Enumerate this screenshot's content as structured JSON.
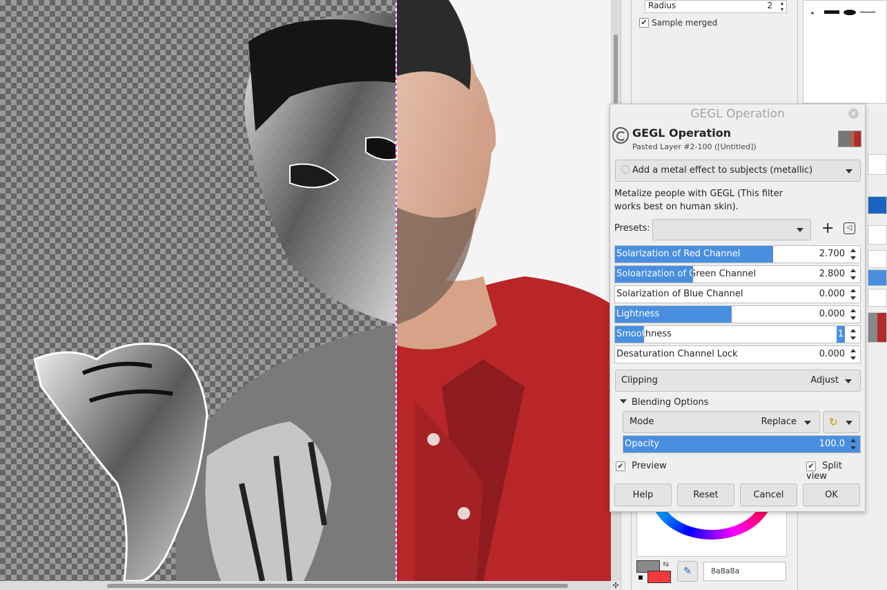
{
  "canvas": {
    "split_view_enabled": true
  },
  "tool_options": {
    "radius_label": "Radius",
    "radius_value": "2",
    "sample_merged_label": "Sample merged",
    "sample_merged_checked": true
  },
  "colors": {
    "foreground": "#8a8a8a",
    "background": "#f23a3a",
    "hex_value": "8a8a8a",
    "accent": "#4a8fdf"
  },
  "dialog": {
    "window_title": "GEGL Operation",
    "close_icon": "close-icon",
    "heading": "GEGL Operation",
    "subheading": "Pasted Layer #2-100 ([Untitled])",
    "filter_selected": "Add a metal effect to subjects (metallic)",
    "description": "Metalize people with GEGL (This filter works best on human skin).",
    "presets_label": "Presets:",
    "presets_value": "",
    "add_preset_glyph": "+",
    "preset_menu_glyph": "◁",
    "sliders": [
      {
        "label": "Solarization of Red Channel",
        "value": "2.700",
        "fill_fraction": 0.645
      },
      {
        "label": "Soloarization of Green Channel",
        "value": "2.800",
        "fill_fraction": 0.317
      },
      {
        "label": "Solarization of Blue Channel",
        "value": "0.000",
        "fill_fraction": 0.0
      },
      {
        "label": "Lightness",
        "value": "0.000",
        "fill_fraction": 0.477
      },
      {
        "label": "Smoothness",
        "value": "1",
        "fill_fraction": 0.118
      },
      {
        "label": "Desaturation Channel Lock",
        "value": "0.000",
        "fill_fraction": 0.0
      }
    ],
    "clipping_label": "Clipping",
    "clipping_value": "Adjust",
    "blending_header": "Blending Options",
    "mode_label": "Mode",
    "mode_value": "Replace",
    "opacity_label": "Opacity",
    "opacity_value": "100.0",
    "preview_label": "Preview",
    "preview_checked": true,
    "split_view_label": "Split view",
    "split_view_checked": true,
    "buttons": {
      "help": "Help",
      "reset": "Reset",
      "cancel": "Cancel",
      "ok": "OK"
    }
  }
}
